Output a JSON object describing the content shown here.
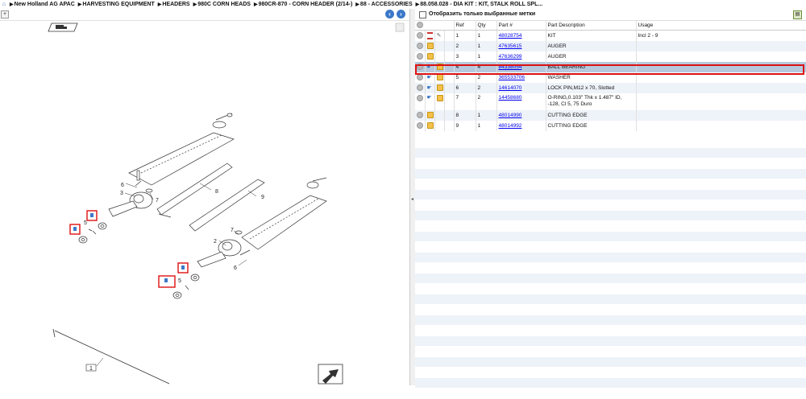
{
  "breadcrumb": [
    "New Holland AG APAC",
    "HARVESTING EQUIPMENT",
    "HEADERS",
    "980C CORN HEADS",
    "980CR-870 - CORN HEADER (2/14-)",
    "88 - ACCESSORIES",
    "88.058.028 - DIA KIT : KIT, STALK ROLL SPL..."
  ],
  "filter_label": "Отобразить только выбранные метки",
  "columns": [
    "Ref",
    "Qty",
    "Part #",
    "Part Description",
    "Usage"
  ],
  "rows": [
    {
      "ref": "1",
      "qty": "1",
      "part": "48028754",
      "desc": "KIT",
      "usage": "Incl 2 - 9",
      "icon": "kit"
    },
    {
      "ref": "2",
      "qty": "1",
      "part": "47635615",
      "desc": "AUGER",
      "usage": "",
      "icon": "pkg"
    },
    {
      "ref": "3",
      "qty": "1",
      "part": "47636299",
      "desc": "AUGER",
      "usage": "",
      "icon": "pkg"
    },
    {
      "ref": "4",
      "qty": "4",
      "part": "84338054",
      "desc": "BALL BEARING",
      "usage": "",
      "icon": "hand"
    },
    {
      "ref": "5",
      "qty": "2",
      "part": "365533706",
      "desc": "WASHER",
      "usage": "",
      "icon": "hand"
    },
    {
      "ref": "6",
      "qty": "2",
      "part": "14614070",
      "desc": "LOCK PIN,M12 x 70, Slotted",
      "usage": "",
      "icon": "hand"
    },
    {
      "ref": "7",
      "qty": "2",
      "part": "14458680",
      "desc": "O-RING,0.103\" Thk x 1.487\" ID, -128, Cl 5, 75 Duro",
      "usage": "",
      "icon": "hand"
    },
    {
      "ref": "8",
      "qty": "1",
      "part": "48014990",
      "desc": "CUTTING EDGE",
      "usage": "",
      "icon": "pkg"
    },
    {
      "ref": "9",
      "qty": "1",
      "part": "48014992",
      "desc": "CUTTING EDGE",
      "usage": "",
      "icon": "pkg"
    }
  ],
  "diagram": {
    "callouts": [
      "1",
      "2",
      "3",
      "4",
      "5",
      "6",
      "7",
      "8",
      "9"
    ]
  }
}
